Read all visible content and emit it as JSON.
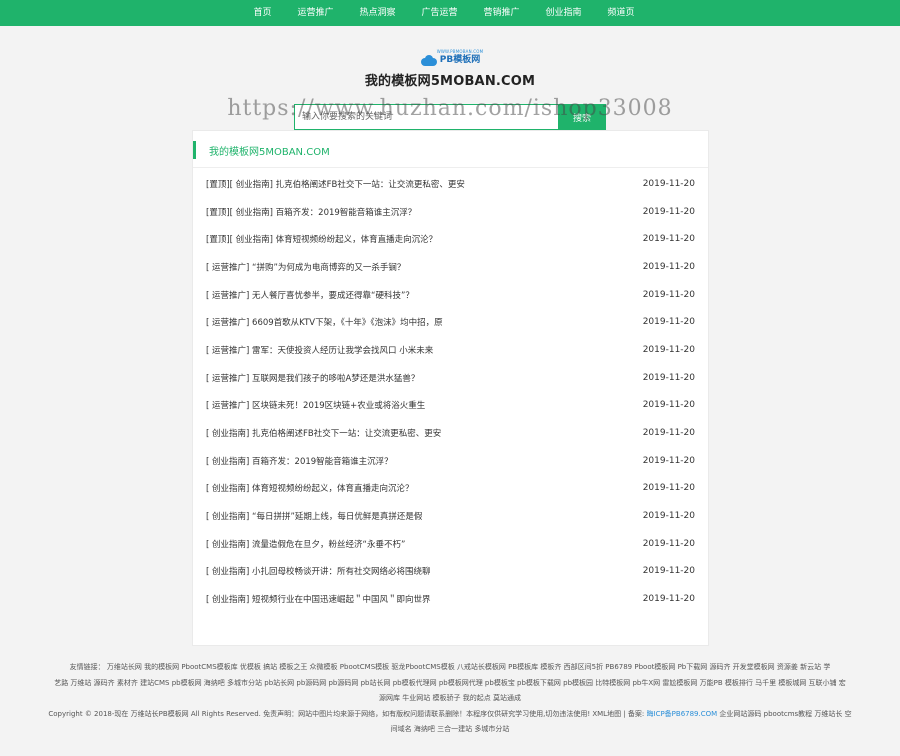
{
  "nav": [
    "首页",
    "运营推广",
    "热点洞察",
    "广告运营",
    "营销推广",
    "创业指南",
    "频道页"
  ],
  "logo": {
    "small": "WWW.PBMOBAN.COM",
    "main": "PB模板网"
  },
  "site_title": "我的模板网5MOBAN.COM",
  "search": {
    "placeholder": "输入你要搜索的关键词",
    "button": "搜索"
  },
  "watermark": "https://www.huzhan.com/ishop33008",
  "panel_title": "我的模板网5MOBAN.COM",
  "articles": [
    {
      "title": "[置顶][ 创业指南] 扎克伯格阐述FB社交下一站：让交流更私密、更安",
      "date": "2019-11-20"
    },
    {
      "title": "[置顶][ 创业指南] 百箱齐发：2019智能音箱谁主沉浮？",
      "date": "2019-11-20"
    },
    {
      "title": "[置顶][ 创业指南] 体育短视频纷纷起义，体育直播走向沉沦？",
      "date": "2019-11-20"
    },
    {
      "title": "[ 运营推广] “拼购”为何成为电商博弈的又一杀手锏？",
      "date": "2019-11-20"
    },
    {
      "title": "[ 运营推广] 无人餐厅喜忧参半，要成还得靠“硬科技”？",
      "date": "2019-11-20"
    },
    {
      "title": "[ 运营推广] 6609首歌从KTV下架，《十年》《泡沫》均中招，原",
      "date": "2019-11-20"
    },
    {
      "title": "[ 运营推广] 雷军：天使投资人经历让我学会找风口 小米未来",
      "date": "2019-11-20"
    },
    {
      "title": "[ 运营推广] 互联网是我们孩子的哆啦A梦还是洪水猛兽？",
      "date": "2019-11-20"
    },
    {
      "title": "[ 运营推广] 区块链未死！2019区块链+农业或将浴火重生",
      "date": "2019-11-20"
    },
    {
      "title": "[ 创业指南] 扎克伯格阐述FB社交下一站：让交流更私密、更安",
      "date": "2019-11-20"
    },
    {
      "title": "[ 创业指南] 百箱齐发：2019智能音箱谁主沉浮？",
      "date": "2019-11-20"
    },
    {
      "title": "[ 创业指南] 体育短视频纷纷起义，体育直播走向沉沦？",
      "date": "2019-11-20"
    },
    {
      "title": "[ 创业指南] “每日拼拼”延期上线，每日优鲜是真拼还是假",
      "date": "2019-11-20"
    },
    {
      "title": "[ 创业指南] 流量造假危在旦夕，粉丝经济“永垂不朽”",
      "date": "2019-11-20"
    },
    {
      "title": "[ 创业指南] 小扎回母校畅谈开讲：所有社交网络必将围绕聊",
      "date": "2019-11-20"
    },
    {
      "title": "[ 创业指南] 短视频行业在中国迅速崛起＂中国风＂即向世界",
      "date": "2019-11-20"
    }
  ],
  "footer": {
    "links_line1": "友情链接： 万维站长网 我的模板网 PbootCMS模板库 优模板 搞站 模板之王 众微模板 PbootCMS模板 驱龙PbootCMS模板 八戒站长模板网 PB模板库 模板齐 西部区间5折 PB6789 Pboot模板网 Pb下载网 源码齐 开发堂模板网 资源姜 新云站 学",
    "links_line2": "艺路 万维站 源码齐 素材齐 建站CMS pb模板网 海纳吧 多城市分站 pb站长网 pb源码网 pb源码网 pb站长网 pb模板代理网 pb模板网代理 pb模板宝 pb模板下载网 pb模板园 比特模板网 pb牛X网 雷尬模板网 万能PB 模板排行 马千里 模板城网 互联小铺 宏",
    "links_line3": "源网库 牛业网站 模板骄子 我的起点 莫站通成",
    "copyright": "Copyright © 2018-现在 万维站长PB模板网 All Rights Reserved. 免责声明：网站中图片均来源于网络，如有版权问题请联系删除！本程序仅供研究学习使用,切勿违法使用! XML地图 | 备案:",
    "icp": "晦ICP备PB6789.COM",
    "copyright_tail": " 企业网站源码 pbootcms教程 万维站长 空",
    "line_last": "间域名 海纳吧 三合一建站 多城市分站"
  }
}
